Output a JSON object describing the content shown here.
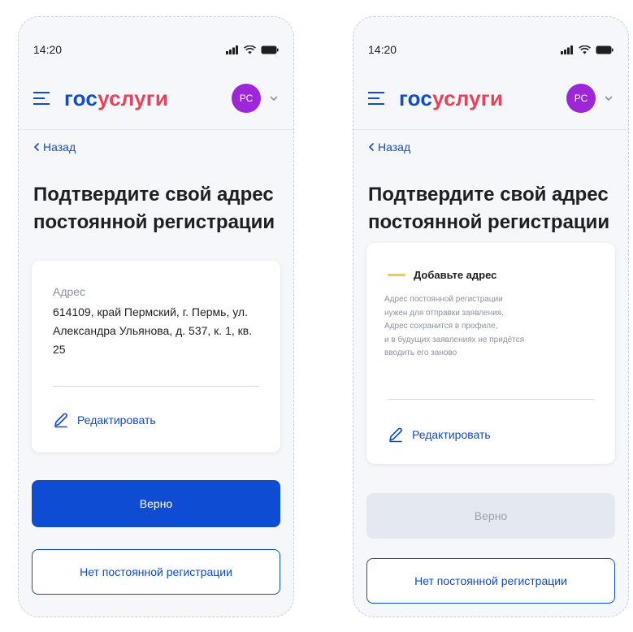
{
  "status": {
    "time": "14:20"
  },
  "header": {
    "logo_gos": "гос",
    "logo_uslugi": "услуги",
    "avatar_initials": "РС"
  },
  "nav": {
    "back_label": "Назад"
  },
  "screens": {
    "left": {
      "title": "Подтвердите свой адрес постоянной регистрации",
      "address_label": "Адрес",
      "address_value": "614109, край Пермский, г. Пермь, ул. Александра Ульянова, д. 537, к. 1, кв. 25",
      "edit_label": "Редактировать",
      "confirm_label": "Верно",
      "no_registration_label": "Нет постоянной регистрации"
    },
    "right": {
      "title": "Подтвердите свой адрес постоянной регистрации",
      "warning_title": "Добавьте адрес",
      "warning_text": "Адрес постоянной регистрации\nнужен для отправки заявления.\nАдрес сохранится в профиле,\nи в будущих заявлениях не придётся\nвводить его заново",
      "edit_label": "Редактировать",
      "confirm_label": "Верно",
      "no_registration_label": "Нет постоянной регистрации"
    }
  },
  "colors": {
    "brand_blue": "#0d4cd3",
    "brand_red": "#ee3f58",
    "avatar_purple": "#9d26d9",
    "warning_yellow": "#f7c93d",
    "disabled_bg": "#e4e9ef"
  },
  "icons": {
    "menu": "menu-icon",
    "chevron": "chevron-down-icon",
    "back": "chevron-left-icon",
    "edit": "pencil-icon",
    "signal": "signal-icon",
    "wifi": "wifi-icon",
    "battery": "battery-icon"
  }
}
